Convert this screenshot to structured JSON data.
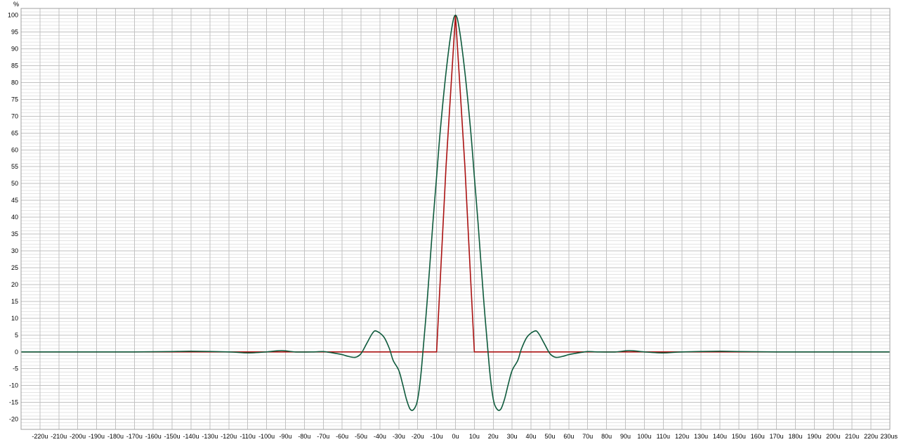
{
  "chart_data": {
    "type": "line",
    "title": "",
    "xlabel": "",
    "ylabel": "",
    "y_unit_label": "%",
    "x_unit_suffix": "us",
    "xlim": [
      -230,
      230
    ],
    "ylim": [
      -23,
      102
    ],
    "grid": true,
    "minor_grid": true,
    "legend": "none",
    "x_ticks": [
      -220,
      -210,
      -200,
      -190,
      -180,
      -170,
      -160,
      -150,
      -140,
      -130,
      -120,
      -110,
      -100,
      -90,
      -80,
      -70,
      -60,
      -50,
      -40,
      -30,
      -20,
      -10,
      0,
      10,
      20,
      30,
      40,
      50,
      60,
      70,
      80,
      90,
      100,
      110,
      120,
      130,
      140,
      150,
      160,
      170,
      180,
      190,
      200,
      210,
      220,
      230
    ],
    "x_tick_labels": [
      "-220u",
      "-210u",
      "-200u",
      "-190u",
      "-180u",
      "-170u",
      "-160u",
      "-150u",
      "-140u",
      "-130u",
      "-120u",
      "-110u",
      "-100u",
      "-90u",
      "-80u",
      "-70u",
      "-60u",
      "-50u",
      "-40u",
      "-30u",
      "-20u",
      "-10u",
      "0u",
      "10u",
      "20u",
      "30u",
      "40u",
      "50u",
      "60u",
      "70u",
      "80u",
      "90u",
      "100u",
      "110u",
      "120u",
      "130u",
      "140u",
      "150u",
      "160u",
      "170u",
      "180u",
      "190u",
      "200u",
      "210u",
      "220u",
      "230us"
    ],
    "y_ticks": [
      100,
      95,
      90,
      85,
      80,
      75,
      70,
      65,
      60,
      55,
      50,
      45,
      40,
      35,
      30,
      25,
      20,
      15,
      10,
      5,
      0,
      -5,
      -10,
      -15,
      -20
    ],
    "y_tick_labels": [
      "100",
      "95",
      "90",
      "85",
      "80",
      "75",
      "70",
      "65",
      "60",
      "55",
      "50",
      "45",
      "40",
      "35",
      "30",
      "25",
      "20",
      "15",
      "10",
      "5",
      "0",
      "-5",
      "-10",
      "-15",
      "-20"
    ],
    "series": [
      {
        "color": "#aa1111",
        "x": [
          -230,
          -11,
          -10,
          -5,
          0,
          5,
          10,
          11,
          230
        ],
        "y": [
          0,
          0,
          0,
          55,
          100,
          55,
          0,
          0,
          0
        ]
      },
      {
        "color": "#0e5a3c",
        "x": [
          -230,
          -200,
          -170,
          -150,
          -140,
          -120,
          -110,
          -100,
          -92,
          -85,
          -75,
          -70,
          -65,
          -60,
          -57,
          -53,
          -50,
          -47,
          -44,
          -42,
          -38,
          -35,
          -33,
          -30,
          -28,
          -26,
          -24,
          -22,
          -20,
          -18,
          -15,
          -12,
          -10,
          -8,
          -5,
          -2,
          0,
          2,
          5,
          8,
          10,
          12,
          15,
          18,
          20,
          22,
          24,
          26,
          28,
          30,
          33,
          35,
          38,
          42,
          44,
          47,
          50,
          53,
          57,
          60,
          65,
          70,
          75,
          85,
          92,
          100,
          110,
          120,
          140,
          150,
          170,
          200,
          230
        ],
        "y": [
          0,
          0,
          0,
          0.1,
          0.2,
          0,
          -0.3,
          0,
          0.4,
          0,
          0,
          0.1,
          -0.3,
          -0.8,
          -1.3,
          -1.6,
          -0.5,
          2.5,
          5.5,
          6.2,
          4.5,
          1,
          -2.5,
          -5.5,
          -9.5,
          -14,
          -17,
          -17,
          -14,
          -5,
          15,
          38,
          52,
          66,
          83,
          96,
          100,
          96,
          83,
          66,
          52,
          38,
          15,
          -5,
          -14,
          -17,
          -17,
          -14,
          -9.5,
          -5.5,
          -2.5,
          1,
          4.5,
          6.2,
          5.5,
          2.5,
          -0.5,
          -1.6,
          -1.3,
          -0.8,
          -0.3,
          0.1,
          0,
          0,
          0.4,
          0,
          -0.3,
          0,
          0.2,
          0.1,
          0,
          0,
          0
        ]
      }
    ]
  },
  "colors": {
    "background": "#ffffff",
    "frame": "#a0a0a0",
    "major_grid": "#c2c2c2",
    "minor_grid": "#e4e4e4",
    "zero_line": "#7a7a7a"
  }
}
